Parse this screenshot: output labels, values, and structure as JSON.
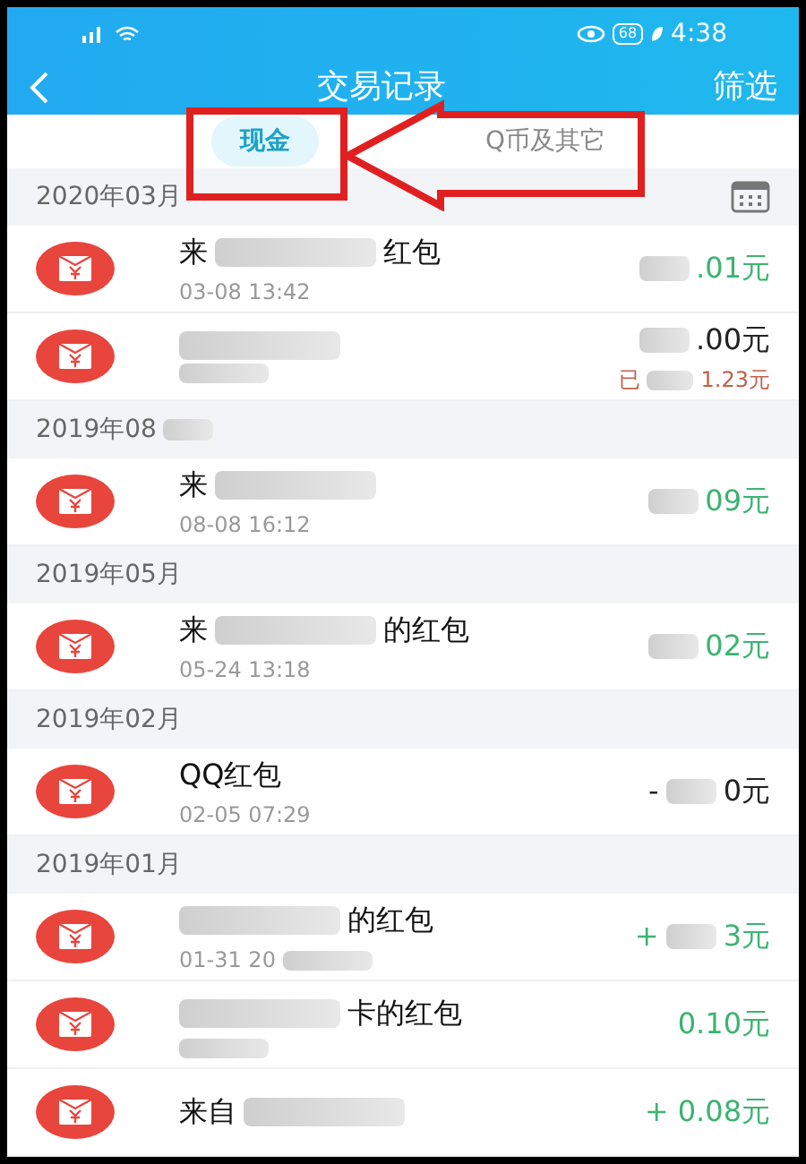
{
  "status_bar": {
    "battery": "68",
    "time": "4:38"
  },
  "header": {
    "title": "交易记录",
    "action": "筛选"
  },
  "tabs": [
    {
      "label": "现金",
      "selected": true
    },
    {
      "label": "Q币及其它",
      "selected": false
    }
  ],
  "sections": [
    {
      "title": [
        {
          "kind": "text",
          "text": "2020年03月"
        }
      ],
      "calendar": true,
      "rows": [
        {
          "title": [
            {
              "kind": "text",
              "text": "来"
            },
            {
              "kind": "blur"
            },
            {
              "kind": "text",
              "text": "红包"
            }
          ],
          "time": [
            {
              "kind": "text",
              "text": "03-08 13:42"
            }
          ],
          "color": "#3cb371",
          "amount": [
            {
              "kind": "blur"
            },
            {
              "kind": "text",
              "text": ".01元"
            }
          ]
        },
        {
          "title": [
            {
              "kind": "blur"
            }
          ],
          "time": [
            {
              "kind": "blur"
            }
          ],
          "color": "#222222",
          "amount": [
            {
              "kind": "blur"
            },
            {
              "kind": "text",
              "text": ".00元"
            }
          ],
          "note": [
            {
              "kind": "text",
              "text": "已"
            },
            {
              "kind": "blur"
            },
            {
              "kind": "text",
              "text": "1.23元"
            }
          ]
        }
      ]
    },
    {
      "title": [
        {
          "kind": "text",
          "text": "2019年08"
        },
        {
          "kind": "blur"
        }
      ],
      "calendar": false,
      "rows": [
        {
          "title": [
            {
              "kind": "text",
              "text": "来"
            },
            {
              "kind": "blur"
            }
          ],
          "time": [
            {
              "kind": "text",
              "text": "08-08 16:12"
            }
          ],
          "color": "#3cb371",
          "amount": [
            {
              "kind": "blur"
            },
            {
              "kind": "text",
              "text": "09元"
            }
          ]
        }
      ]
    },
    {
      "title": [
        {
          "kind": "text",
          "text": "2019年05月"
        }
      ],
      "calendar": false,
      "rows": [
        {
          "title": [
            {
              "kind": "text",
              "text": "来"
            },
            {
              "kind": "blur"
            },
            {
              "kind": "text",
              "text": "的红包"
            }
          ],
          "time": [
            {
              "kind": "text",
              "text": "05-24 13:18"
            }
          ],
          "color": "#3cb371",
          "amount": [
            {
              "kind": "blur"
            },
            {
              "kind": "text",
              "text": "02元"
            }
          ]
        }
      ]
    },
    {
      "title": [
        {
          "kind": "text",
          "text": "2019年02月"
        }
      ],
      "calendar": false,
      "rows": [
        {
          "title": [
            {
              "kind": "text",
              "text": "QQ红包"
            }
          ],
          "time": [
            {
              "kind": "text",
              "text": "02-05 07:29"
            }
          ],
          "color": "#222222",
          "amount": [
            {
              "kind": "text",
              "text": "-"
            },
            {
              "kind": "blur"
            },
            {
              "kind": "text",
              "text": "0元"
            }
          ]
        }
      ]
    },
    {
      "title": [
        {
          "kind": "text",
          "text": "2019年01月"
        }
      ],
      "calendar": false,
      "rows": [
        {
          "title": [
            {
              "kind": "blur"
            },
            {
              "kind": "text",
              "text": "的红包"
            }
          ],
          "time": [
            {
              "kind": "text",
              "text": "01-31 20"
            },
            {
              "kind": "blur"
            }
          ],
          "color": "#3cb371",
          "amount": [
            {
              "kind": "text",
              "text": "+"
            },
            {
              "kind": "blur"
            },
            {
              "kind": "text",
              "text": "3元"
            }
          ]
        },
        {
          "title": [
            {
              "kind": "blur"
            },
            {
              "kind": "text",
              "text": "卡的红包"
            }
          ],
          "time": [
            {
              "kind": "blur"
            }
          ],
          "color": "#3cb371",
          "amount": [
            {
              "kind": "text",
              "text": "0.10元"
            }
          ]
        },
        {
          "title": [
            {
              "kind": "text",
              "text": "来自"
            },
            {
              "kind": "blur"
            }
          ],
          "time": [],
          "color": "#3cb371",
          "amount": [
            {
              "kind": "text",
              "text": "+ 0.08元"
            }
          ]
        }
      ]
    }
  ]
}
